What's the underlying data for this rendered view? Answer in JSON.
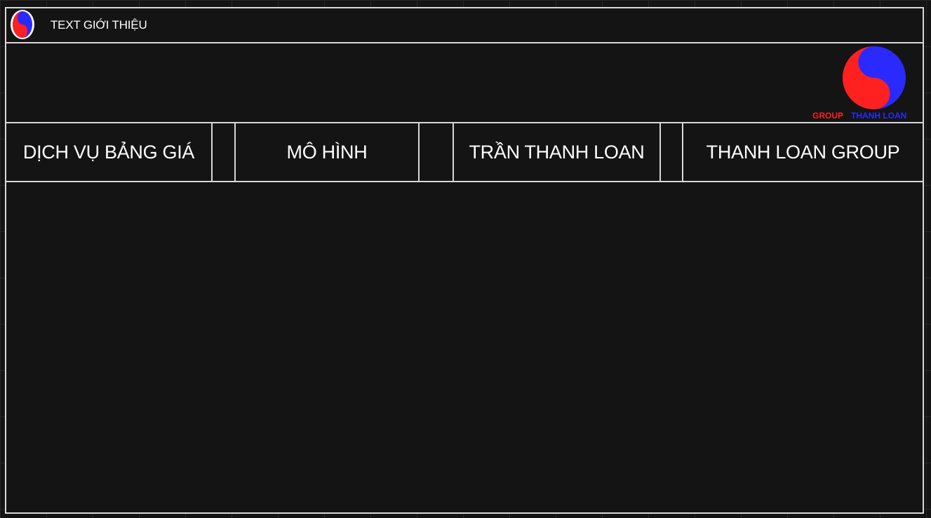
{
  "colors": {
    "background": "#141414",
    "border": "#d8d8d8",
    "brand_red": "#ff2020",
    "brand_blue": "#2a2aff"
  },
  "topbar": {
    "title": "TEXT GIỚI THIỆU",
    "logo_icon": "yin-yang-logo-icon"
  },
  "banner": {
    "logo_icon": "yin-yang-logo-icon",
    "brand_left": "GROUP",
    "brand_right": "THANH LOAN"
  },
  "nav": {
    "items": [
      {
        "label": "DỊCH VỤ BẢNG GIÁ"
      },
      {
        "label": "MÔ HÌNH"
      },
      {
        "label": "TRẦN THANH LOAN"
      },
      {
        "label": "THANH LOAN GROUP"
      }
    ]
  }
}
